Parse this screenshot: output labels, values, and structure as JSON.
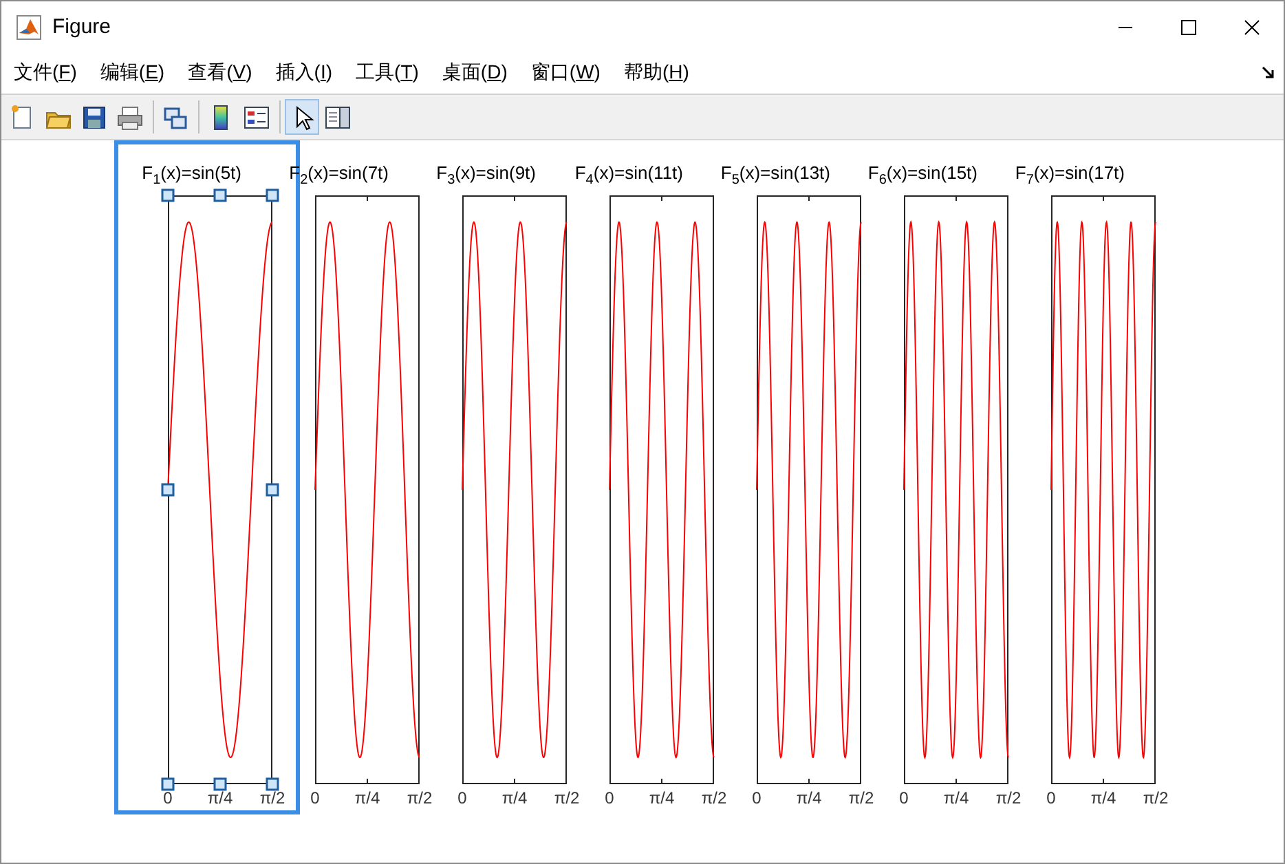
{
  "window": {
    "title": "Figure"
  },
  "menu": [
    {
      "before": "文件(",
      "key": "F",
      "after": ")"
    },
    {
      "before": "编辑(",
      "key": "E",
      "after": ")"
    },
    {
      "before": "查看(",
      "key": "V",
      "after": ")"
    },
    {
      "before": "插入(",
      "key": "I",
      "after": ")"
    },
    {
      "before": "工具(",
      "key": "T",
      "after": ")"
    },
    {
      "before": "桌面(",
      "key": "D",
      "after": ")"
    },
    {
      "before": "窗口(",
      "key": "W",
      "after": ")"
    },
    {
      "before": "帮助(",
      "key": "H",
      "after": ")"
    }
  ],
  "toolbar": [
    {
      "kind": "new",
      "selected": false
    },
    {
      "kind": "open",
      "selected": false
    },
    {
      "kind": "save",
      "selected": false
    },
    {
      "kind": "print",
      "selected": false
    },
    {
      "kind": "separator"
    },
    {
      "kind": "link",
      "selected": false
    },
    {
      "kind": "separator"
    },
    {
      "kind": "colorbar",
      "selected": false
    },
    {
      "kind": "legend",
      "selected": false
    },
    {
      "kind": "separator"
    },
    {
      "kind": "pointer",
      "selected": true
    },
    {
      "kind": "panel",
      "selected": false
    }
  ],
  "plots": [
    {
      "title": "F$_{1}$(x)=sin(5t)",
      "selected": true,
      "xticks": [
        "0",
        "π/4",
        "π/2"
      ]
    },
    {
      "title": "F$_{2}$(x)=sin(7t)",
      "selected": false,
      "xticks": [
        "0",
        "π/4",
        "π/2"
      ]
    },
    {
      "title": "F$_{3}$(x)=sin(9t)",
      "selected": false,
      "xticks": [
        "0",
        "π/4",
        "π/2"
      ]
    },
    {
      "title": "F$_{4}$(x)=sin(11t)",
      "selected": false,
      "xticks": [
        "0",
        "π/4",
        "π/2"
      ]
    },
    {
      "title": "F$_{5}$(x)=sin(13t)",
      "selected": false,
      "xticks": [
        "0",
        "π/4",
        "π/2"
      ]
    },
    {
      "title": "F$_{6}$(x)=sin(15t)",
      "selected": false,
      "xticks": [
        "0",
        "π/4",
        "π/2"
      ]
    },
    {
      "title": "F$_{7}$(x)=sin(17t)",
      "selected": false,
      "xticks": [
        "0",
        "π/4",
        "π/2"
      ]
    }
  ]
}
